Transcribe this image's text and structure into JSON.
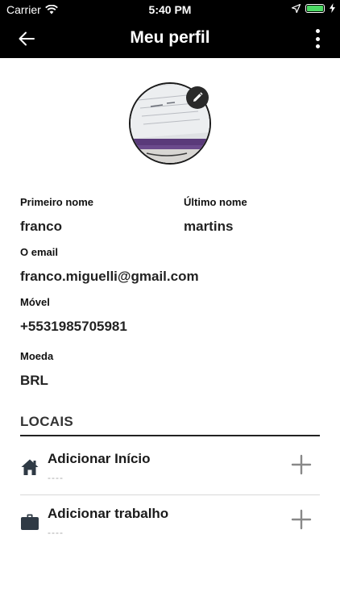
{
  "status_bar": {
    "carrier": "Carrier",
    "time": "5:40 PM",
    "battery_level_percent": 100
  },
  "app_bar": {
    "title": "Meu perfil"
  },
  "profile": {
    "first_name_label": "Primeiro nome",
    "first_name": "franco",
    "last_name_label": "Último nome",
    "last_name": "martins",
    "email_label": "O email",
    "email": "franco.miguelli@gmail.com",
    "mobile_label": "Móvel",
    "mobile": "+5531985705981",
    "currency_label": "Moeda",
    "currency": "BRL"
  },
  "locations": {
    "title": "LOCAIS",
    "items": [
      {
        "label": "Adicionar Início",
        "value": "----",
        "icon": "home-icon"
      },
      {
        "label": "Adicionar trabalho",
        "value": "----",
        "icon": "briefcase-icon"
      }
    ]
  },
  "colors": {
    "app_bar_bg": "#000000",
    "accent_battery": "#4cd964",
    "plus_icon": "#888888"
  }
}
